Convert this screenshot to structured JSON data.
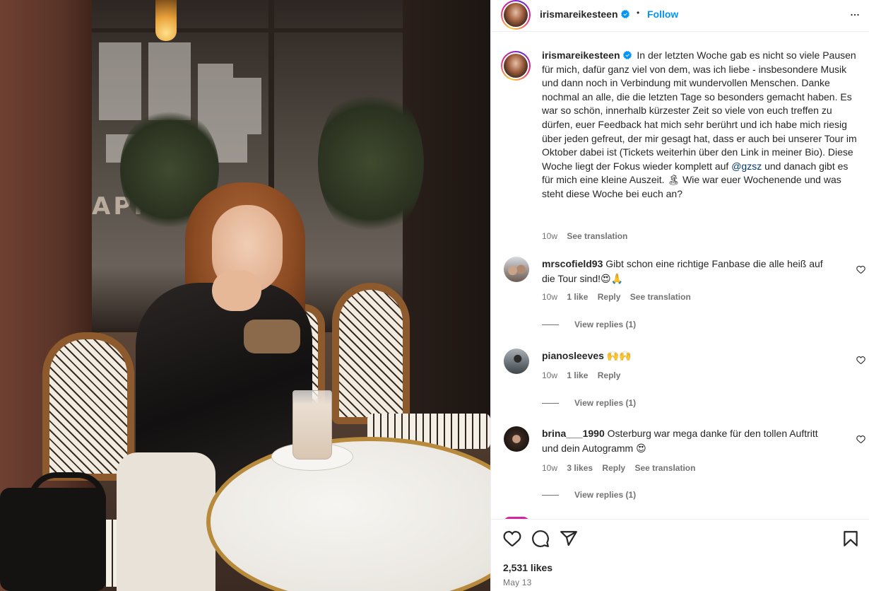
{
  "post": {
    "author": "irismareikesteen",
    "follow_label": "Follow",
    "separator": "•",
    "caption_author": "irismareikesteen",
    "caption_part1": "In der letzten Woche gab es nicht so viele Pausen für mich, dafür ganz viel von dem, was ich liebe - insbesondere Musik und dann noch in Verbindung mit wundervollen Menschen. Danke nochmal an alle, die die letzten Tage so besonders gemacht haben. Es war so schön, innerhalb kürzester Zeit so viele von euch treffen zu dürfen, euer Feedback hat mich sehr berührt und ich habe mich riesig über jeden gefreut, der mir gesagt hat, dass er auch bei unserer Tour im Oktober dabei ist (Tickets weiterhin über den Link in meiner Bio). Diese Woche liegt der Fokus wieder komplett auf ",
    "caption_mention": "@gzsz",
    "caption_part2": " und danach gibt es für mich eine kleine Auszeit. 🏝 Wie war euer Wochenende und was steht diese Woche bei euch an?",
    "caption_time": "10w",
    "caption_translate": "See translation",
    "likes": "2,531 likes",
    "date": "May 13"
  },
  "comments": [
    {
      "username": "mrscofield93",
      "text": "Gibt schon eine richtige Fanbase die alle heiß auf die Tour sind!😍🙏",
      "time": "10w",
      "likes": "1 like",
      "reply": "Reply",
      "translate": "See translation",
      "view_replies": "View replies (1)"
    },
    {
      "username": "pianosleeves",
      "text": "🙌🙌",
      "time": "10w",
      "likes": "1 like",
      "reply": "Reply",
      "view_replies": "View replies (1)"
    },
    {
      "username": "brina___1990",
      "text": "Osterburg war mega danke für den tollen Auftritt und dein Autogramm 😍",
      "time": "10w",
      "likes": "3 likes",
      "reply": "Reply",
      "translate": "See translation",
      "view_replies": "View replies (1)"
    }
  ],
  "photo": {
    "sign_text": "APPUCC"
  },
  "icons": {
    "header": [
      "verified-badge-icon",
      "more-options-icon"
    ],
    "actions": [
      "heart-icon",
      "comment-icon",
      "share-icon",
      "bookmark-icon"
    ],
    "comment_like": "heart-icon"
  },
  "colors": {
    "accent": "#0095f6",
    "verified": "#0095f6",
    "mention": "#00376b",
    "secondary_text": "#737373"
  }
}
